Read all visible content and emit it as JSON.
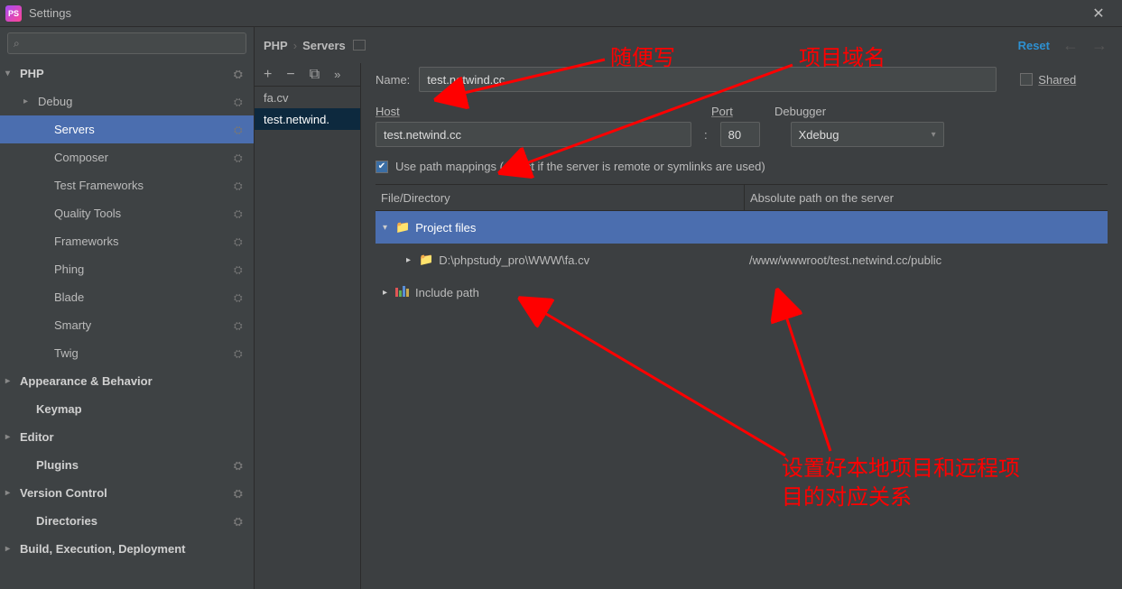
{
  "window": {
    "title": "Settings"
  },
  "sidebar": {
    "search_placeholder": "",
    "groups": {
      "php": "PHP",
      "appearance": "Appearance & Behavior",
      "keymap": "Keymap",
      "editor": "Editor",
      "plugins": "Plugins",
      "vcs": "Version Control",
      "directories": "Directories",
      "build": "Build, Execution, Deployment"
    },
    "php_children": {
      "debug": "Debug",
      "servers": "Servers",
      "composer": "Composer",
      "test_frameworks": "Test Frameworks",
      "quality_tools": "Quality Tools",
      "frameworks": "Frameworks",
      "phing": "Phing",
      "blade": "Blade",
      "smarty": "Smarty",
      "twig": "Twig"
    }
  },
  "breadcrumb": {
    "root": "PHP",
    "leaf": "Servers"
  },
  "actions": {
    "reset": "Reset"
  },
  "server_list": {
    "item0": "fa.cv",
    "item1": "test.netwind."
  },
  "form": {
    "name_label": "Name:",
    "name_value": "test.netwind.cc",
    "shared_label": "Shared",
    "host_label": "Host",
    "host_value": "test.netwind.cc",
    "port_label": "Port",
    "port_sep": ":",
    "port_value": "80",
    "debugger_label": "Debugger",
    "debugger_value": "Xdebug",
    "use_mappings_label": "Use path mappings (select if the server is remote or symlinks are used)"
  },
  "mapping": {
    "col1": "File/Directory",
    "col2": "Absolute path on the server",
    "project_files": "Project files",
    "local_path": "D:\\phpstudy_pro\\WWW\\fa.cv",
    "remote_path": "/www/wwwroot/test.netwind.cc/public",
    "include_path": "Include path"
  },
  "annotations": {
    "a1": "随便写",
    "a2": "项目域名",
    "a3_l1": "设置好本地项目和远程项",
    "a3_l2": "目的对应关系"
  }
}
